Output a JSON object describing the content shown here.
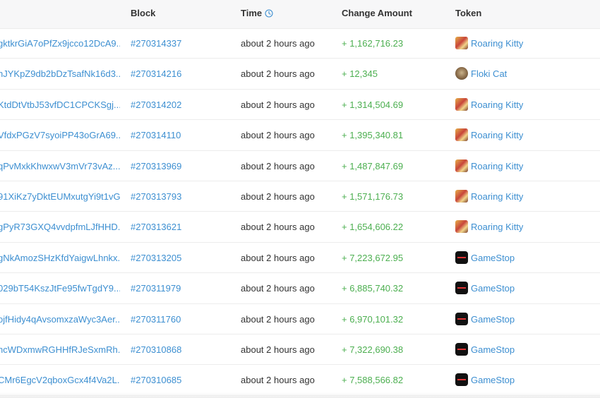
{
  "header": {
    "block": "Block",
    "time": "Time",
    "amount": "Change Amount",
    "token": "Token"
  },
  "rows": [
    {
      "sig": "gktkrGiA7oPfZx9jcco12DcA9...",
      "block": "#270314337",
      "time": "about 2 hours ago",
      "amount": "+ 1,162,716.23",
      "token": "Roaring Kitty",
      "icon": "kitty"
    },
    {
      "sig": "nJYKpZ9db2bDzTsafNk16d3...",
      "block": "#270314216",
      "time": "about 2 hours ago",
      "amount": "+ 12,345",
      "token": "Floki Cat",
      "icon": "floki"
    },
    {
      "sig": "KtdDtVtbJ53vfDC1CPCKSgj...",
      "block": "#270314202",
      "time": "about 2 hours ago",
      "amount": "+ 1,314,504.69",
      "token": "Roaring Kitty",
      "icon": "kitty"
    },
    {
      "sig": "VfdxPGzV7syoiPP43oGrA69...",
      "block": "#270314110",
      "time": "about 2 hours ago",
      "amount": "+ 1,395,340.81",
      "token": "Roaring Kitty",
      "icon": "kitty"
    },
    {
      "sig": "qPvMxkKhwxwV3mVr73vAz...",
      "block": "#270313969",
      "time": "about 2 hours ago",
      "amount": "+ 1,487,847.69",
      "token": "Roaring Kitty",
      "icon": "kitty"
    },
    {
      "sig": "91XiKz7yDktEUMxutgYi9t1vG...",
      "block": "#270313793",
      "time": "about 2 hours ago",
      "amount": "+ 1,571,176.73",
      "token": "Roaring Kitty",
      "icon": "kitty"
    },
    {
      "sig": "gPyR73GXQ4vvdpfmLJfHHD...",
      "block": "#270313621",
      "time": "about 2 hours ago",
      "amount": "+ 1,654,606.22",
      "token": "Roaring Kitty",
      "icon": "kitty"
    },
    {
      "sig": "gNkAmozSHzKfdYaigwLhnkx...",
      "block": "#270313205",
      "time": "about 2 hours ago",
      "amount": "+ 7,223,672.95",
      "token": "GameStop",
      "icon": "gme"
    },
    {
      "sig": "029bT54KszJtFe95fwTgdY9...",
      "block": "#270311979",
      "time": "about 2 hours ago",
      "amount": "+ 6,885,740.32",
      "token": "GameStop",
      "icon": "gme"
    },
    {
      "sig": "ojfHidy4qAvsomxzaWyc3Aer...",
      "block": "#270311760",
      "time": "about 2 hours ago",
      "amount": "+ 6,970,101.32",
      "token": "GameStop",
      "icon": "gme"
    },
    {
      "sig": "ncWDxmwRGHHfRJeSxmRh...",
      "block": "#270310868",
      "time": "about 2 hours ago",
      "amount": "+ 7,322,690.38",
      "token": "GameStop",
      "icon": "gme"
    },
    {
      "sig": "CMr6EgcV2qboxGcx4f4Va2L...",
      "block": "#270310685",
      "time": "about 2 hours ago",
      "amount": "+ 7,588,566.82",
      "token": "GameStop",
      "icon": "gme"
    }
  ]
}
